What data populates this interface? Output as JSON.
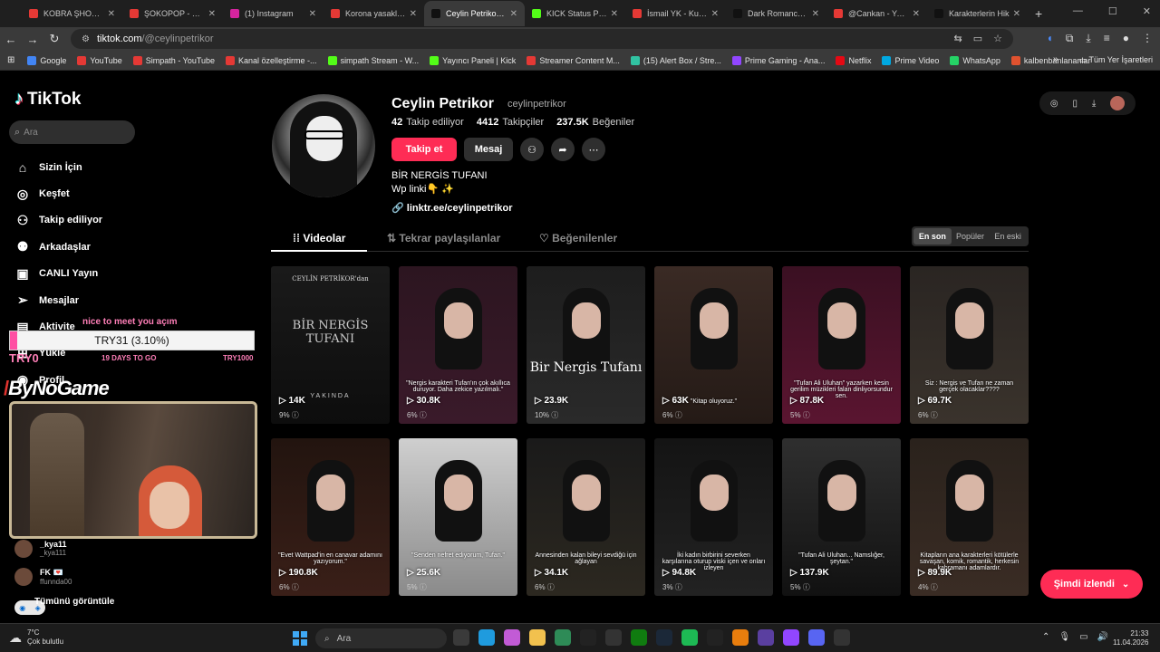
{
  "browser": {
    "tabs": [
      {
        "label": "KOBRA ŞHOW KR",
        "color": "#e53935"
      },
      {
        "label": "ŞOKOPOP - YouT",
        "color": "#e53935"
      },
      {
        "label": "(1) Instagram",
        "color": "#d6249f"
      },
      {
        "label": "Korona yasakları",
        "color": "#e53935"
      },
      {
        "label": "Ceylin Petrikor (@",
        "color": "#111111",
        "active": true
      },
      {
        "label": "KICK Status Page",
        "color": "#53fc18"
      },
      {
        "label": "İsmail YK - Kudur",
        "color": "#e53935"
      },
      {
        "label": "Dark Romance Ki",
        "color": "#111111"
      },
      {
        "label": "@Cankan - Yaran",
        "color": "#e53935"
      },
      {
        "label": "Karakterlerin Hik",
        "color": "#111111"
      }
    ],
    "url_host": "tiktok.com",
    "url_path": "/@ceylinpetrikor",
    "bookmarks": [
      {
        "label": "Google",
        "color": "#4285f4"
      },
      {
        "label": "YouTube",
        "color": "#e53935"
      },
      {
        "label": "Simpath - YouTube",
        "color": "#e53935"
      },
      {
        "label": "Kanal özelleştirme -...",
        "color": "#e53935"
      },
      {
        "label": "simpath Stream - W...",
        "color": "#53fc18"
      },
      {
        "label": "Yayıncı Paneli | Kick",
        "color": "#53fc18"
      },
      {
        "label": "Streamer Content M...",
        "color": "#e53935"
      },
      {
        "label": "(15) Alert Box / Stre...",
        "color": "#31c3a2"
      },
      {
        "label": "Prime Gaming - Ana...",
        "color": "#9146ff"
      },
      {
        "label": "Netflix",
        "color": "#e50914"
      },
      {
        "label": "Prime Video",
        "color": "#00a8e1"
      },
      {
        "label": "WhatsApp",
        "color": "#25d366"
      },
      {
        "label": "kalbenbanlananlar",
        "color": "#e0522f"
      }
    ],
    "bookmarks_all": "Tüm Yer İşaretleri"
  },
  "sidebar": {
    "logo": "TikTok",
    "search_placeholder": "Ara",
    "items": [
      {
        "label": "Sizin İçin",
        "icon": "⌂"
      },
      {
        "label": "Keşfet",
        "icon": "◎"
      },
      {
        "label": "Takip ediliyor",
        "icon": "⚇"
      },
      {
        "label": "Arkadaşlar",
        "icon": "⚉"
      },
      {
        "label": "CANLI Yayın",
        "icon": "▣"
      },
      {
        "label": "Mesajlar",
        "icon": "➢"
      },
      {
        "label": "Aktivite",
        "icon": "▤"
      },
      {
        "label": "Yükle",
        "icon": "⊞"
      },
      {
        "label": "Profil",
        "icon": "◉"
      }
    ],
    "following": [
      {
        "name": "_kya11",
        "sub": "_kya111"
      },
      {
        "name": "FK 💌",
        "sub": "ffunnda00"
      }
    ],
    "see_all": "Tümünü görüntüle"
  },
  "overlay": {
    "title": "nice to meet you açım",
    "goal": "TRY31 (3.10%)",
    "goal_progress": 3.1,
    "left": "TRY0",
    "mid": "19 DAYS TO GO",
    "right": "TRY1000",
    "brand": "ByNoGame"
  },
  "profile": {
    "name": "Ceylin Petrikor",
    "handle": "ceylinpetrikor",
    "following_count": "42",
    "following_label": "Takip ediliyor",
    "followers_count": "4412",
    "followers_label": "Takipçiler",
    "likes_count": "237.5K",
    "likes_label": "Beğeniler",
    "follow_button": "Takip et",
    "message_button": "Mesaj",
    "bio_line1": "BİR NERGİS TUFANI",
    "bio_line2": "Wp linki👇 ✨",
    "link": "linktr.ee/ceylinpetrikor"
  },
  "tabs": {
    "videos": "Videolar",
    "reposts": "Tekrar paylaşılanlar",
    "liked": "Beğenilenler"
  },
  "sort": [
    "En son",
    "Popüler",
    "En eski"
  ],
  "videos": [
    {
      "views": "14K",
      "pct": "9%",
      "bg": "linear-gradient(#1a1a1a,#0d0d0d)",
      "title1": "CEYLİN PETRİKOR'dan",
      "title2": "BİR NERGİS TUFANI",
      "title3": "YAKINDA"
    },
    {
      "views": "30.8K",
      "pct": "6%",
      "bg": "linear-gradient(#2c1520,#3a1a2a)",
      "cap": "\"Nergis karakteri Tufan'ın çok akıllıca duruyor. Daha zekice yazılmalı.\""
    },
    {
      "views": "23.9K",
      "pct": "10%",
      "bg": "linear-gradient(#1d1d1d,#2a2a2a)",
      "bigcap": "Bir Nergis Tufanı"
    },
    {
      "views": "63K",
      "pct": "6%",
      "bg": "linear-gradient(#3a2a24,#241a16)",
      "cap": "\"Kitap oluyoruz.\""
    },
    {
      "views": "87.8K",
      "pct": "5%",
      "bg": "linear-gradient(#3a1022,#5a1530)",
      "cap": "\"Tufan Ali Uluhan\" yazarken kesin gerilim müzikleri falan dinliyorsundur sen."
    },
    {
      "views": "69.7K",
      "pct": "6%",
      "bg": "linear-gradient(#2a2522,#3a332c)",
      "cap": "Siz : Nergis ve Tufan ne zaman gerçek olacaklar????"
    },
    {
      "views": "190.8K",
      "pct": "6%",
      "bg": "linear-gradient(#22140f,#3a1f18)",
      "cap": "\"Evet Wattpad'in en canavar adamını yazıyorum.\""
    },
    {
      "views": "25.6K",
      "pct": "5%",
      "bg": "linear-gradient(#cfcfcf,#8a8a8a)",
      "cap": "\"Senden nefret ediyorum, Tufan.\""
    },
    {
      "views": "34.1K",
      "pct": "6%",
      "bg": "linear-gradient(#1a1a1a,#2c2820)",
      "cap": "Annesinden kalan bileyi sevdiğü için ağlayan"
    },
    {
      "views": "94.8K",
      "pct": "3%",
      "bg": "linear-gradient(#141414,#222)",
      "cap": "İki kadın birbirini severken karşılarına oturup viski içen ve onları izleyen"
    },
    {
      "views": "137.9K",
      "pct": "5%",
      "bg": "linear-gradient(#2f2f2f,#111)",
      "cap": "\"Tufan Ali Uluhan... Namslığer, şeytan.\""
    },
    {
      "views": "89.9K",
      "pct": "4%",
      "bg": "linear-gradient(#2a221c,#3a2c24)",
      "cap": "Kitapların ana karakterleri kötülerle savaşan, komik, romantik, herkesin kahramanı adamlardır."
    }
  ],
  "watched_button": "Şimdi izlendi",
  "taskbar": {
    "temp": "7°C",
    "weather": "Çok bulutlu",
    "search": "Ara",
    "time": "21:33",
    "date": "11.04.2026"
  }
}
